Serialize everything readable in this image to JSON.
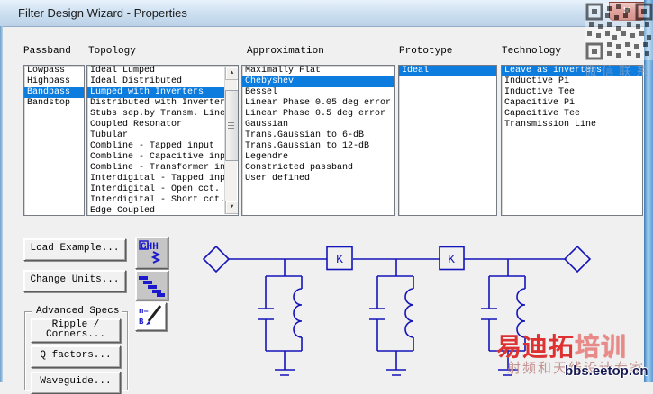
{
  "window": {
    "title": "Filter Design Wizard - Properties",
    "close_glyph": "✕"
  },
  "lists": {
    "passband": {
      "label": "Passband",
      "items": [
        {
          "text": "Lowpass"
        },
        {
          "text": "Highpass"
        },
        {
          "text": "Bandpass",
          "selected": true
        },
        {
          "text": "Bandstop"
        }
      ]
    },
    "topology": {
      "label": "Topology",
      "items": [
        {
          "text": "Ideal Lumped"
        },
        {
          "text": "Ideal Distributed"
        },
        {
          "text": "Lumped with Inverters",
          "selected": true
        },
        {
          "text": "Distributed with Inverters"
        },
        {
          "text": "Stubs sep.by Transm. Line"
        },
        {
          "text": "Coupled Resonator"
        },
        {
          "text": "Tubular"
        },
        {
          "text": "Combline - Tapped input"
        },
        {
          "text": "Combline - Capacitive input"
        },
        {
          "text": "Combline - Transformer input"
        },
        {
          "text": "Interdigital - Tapped input"
        },
        {
          "text": "Interdigital - Open cct."
        },
        {
          "text": "Interdigital - Short cct."
        },
        {
          "text": "Edge Coupled"
        }
      ]
    },
    "approximation": {
      "label": "Approximation",
      "items": [
        {
          "text": "Maximally Flat"
        },
        {
          "text": "Chebyshev",
          "selected": true
        },
        {
          "text": "Bessel"
        },
        {
          "text": "Linear Phase 0.05 deg error"
        },
        {
          "text": "Linear Phase 0.5 deg error"
        },
        {
          "text": "Gaussian"
        },
        {
          "text": "Trans.Gaussian to 6-dB"
        },
        {
          "text": "Trans.Gaussian to 12-dB"
        },
        {
          "text": "Legendre"
        },
        {
          "text": "Constricted passband"
        },
        {
          "text": "User defined"
        }
      ]
    },
    "prototype": {
      "label": "Prototype",
      "items": [
        {
          "text": "Ideal",
          "selected": true
        }
      ]
    },
    "technology": {
      "label": "Technology",
      "items": [
        {
          "text": "Leave as inverters",
          "selected": true
        },
        {
          "text": "Inductive Pi"
        },
        {
          "text": "Inductive Tee"
        },
        {
          "text": "Capacitive Pi"
        },
        {
          "text": "Capacitive Tee"
        },
        {
          "text": "Transmission Line"
        }
      ]
    }
  },
  "buttons": {
    "load_example": "Load Example...",
    "change_units": "Change Units...",
    "advanced_specs_group": "Advanced Specs",
    "ripple_line1": "Ripple /",
    "ripple_line2": "Corners...",
    "q_factors": "Q factors...",
    "waveguide": "Waveguide..."
  },
  "icon_buttons": {
    "filter_response": "filter-response-icon",
    "steps": "steps-icon",
    "order_edit": "order-edit-icon"
  },
  "schematic": {
    "inverter_label": "K"
  },
  "watermarks": {
    "wechat": "微信联系",
    "brand_main": "易迪拓",
    "brand_sub": "培训",
    "tagline": "射频和天线设计专家",
    "site": "bbs.eetop.cn"
  }
}
